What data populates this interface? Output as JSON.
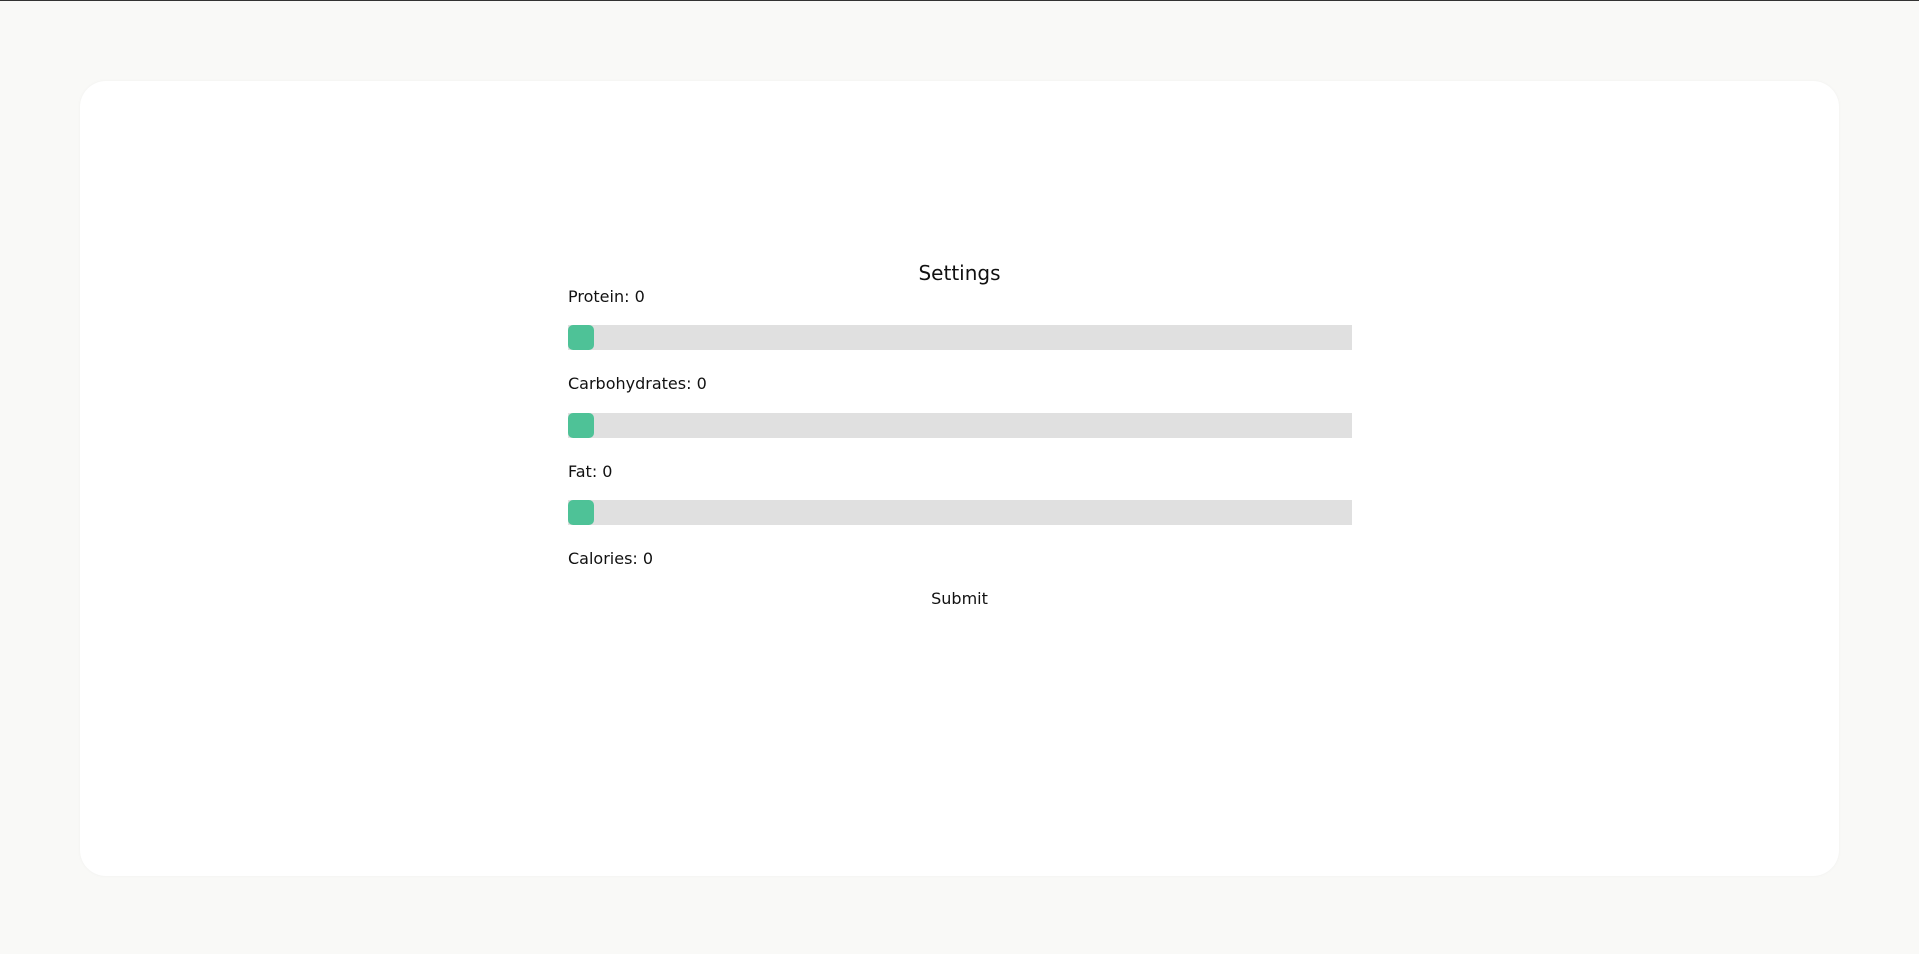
{
  "page": {
    "title": "Settings",
    "submit_label": "Submit",
    "calories": {
      "text": "Calories: 0",
      "value": 0
    }
  },
  "sliders": [
    {
      "key": "protein",
      "label": "Protein: 0",
      "value": 0,
      "min": 0,
      "max": 100
    },
    {
      "key": "carbohydrates",
      "label": "Carbohydrates: 0",
      "value": 0,
      "min": 0,
      "max": 100
    },
    {
      "key": "fat",
      "label": "Fat: 0",
      "value": 0,
      "min": 0,
      "max": 100
    }
  ],
  "colors": {
    "background": "#f9f9f7",
    "card": "#ffffff",
    "track": "#e0e0e0",
    "thumb": "#4ec297",
    "text": "#111111"
  }
}
